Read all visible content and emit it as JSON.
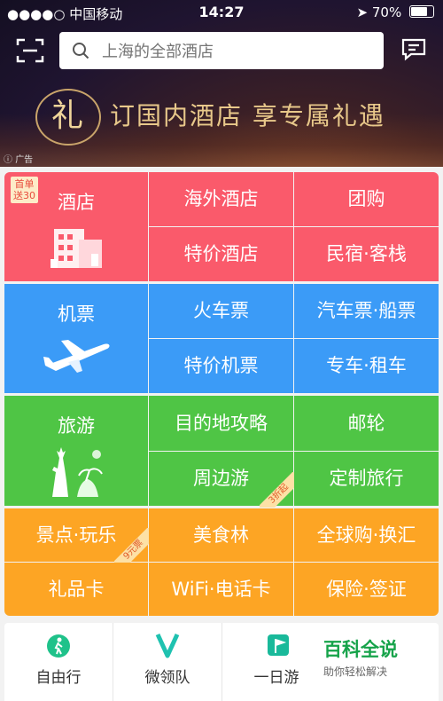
{
  "status_bar": {
    "carrier": "●●●●○ 中国移动",
    "time": "14:27",
    "battery": "70%"
  },
  "search": {
    "placeholder": "上海的全部酒店"
  },
  "banner": {
    "logo_char": "礼",
    "text": "订国内酒店   享专属礼遇",
    "ad_label": "广告"
  },
  "grid": {
    "hotel": {
      "title": "酒店",
      "badge_line1": "首单",
      "badge_line2": "送30",
      "cells": [
        "海外酒店",
        "团购",
        "特价酒店",
        "民宿·客栈"
      ]
    },
    "flight": {
      "title": "机票",
      "cells": [
        "火车票",
        "汽车票·船票",
        "特价机票",
        "专车·租车"
      ]
    },
    "travel": {
      "title": "旅游",
      "cells": [
        "目的地攻略",
        "邮轮",
        "周边游",
        "定制旅行"
      ],
      "corner_badge": "3折起"
    },
    "extra": {
      "cells": [
        "景点·玩乐",
        "美食林",
        "全球购·换汇",
        "礼品卡",
        "WiFi·电话卡",
        "保险·签证"
      ],
      "corner_badge": "9元票"
    }
  },
  "bottom_nav": {
    "items": [
      "自由行",
      "微领队",
      "一日游"
    ]
  },
  "watermark": {
    "title": "百科全说",
    "subtitle": "助你轻松解决"
  },
  "colors": {
    "hotel": "#fa5a6b",
    "flight": "#3b9bf7",
    "travel": "#4fc545",
    "extra": "#fda524",
    "accent": "#16a34a"
  }
}
